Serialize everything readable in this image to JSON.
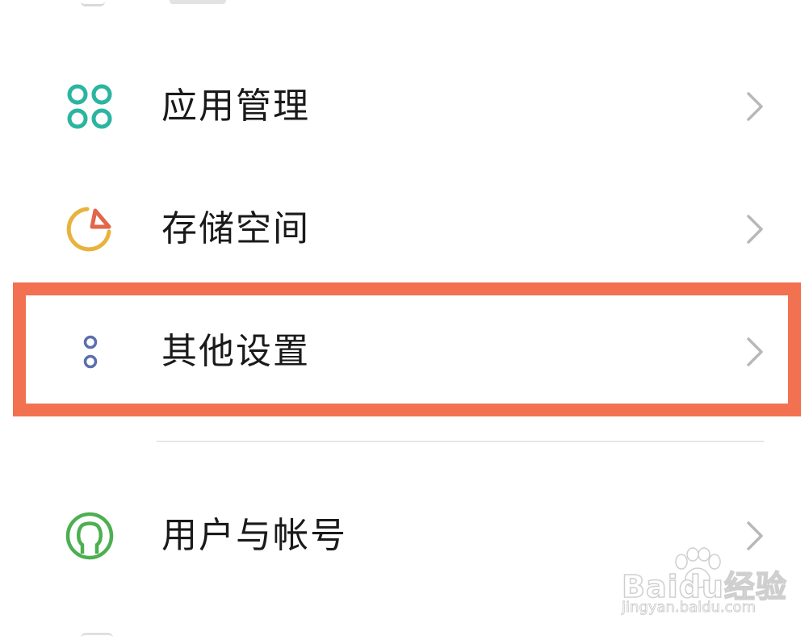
{
  "settings": {
    "items": [
      {
        "label": "应用管理",
        "icon": "app-management-icon",
        "icon_color": "#2bb5a0"
      },
      {
        "label": "存储空间",
        "icon": "storage-icon",
        "icon_color": "#e8b33c",
        "accent_color": "#e2664a"
      },
      {
        "label": "其他设置",
        "icon": "other-settings-icon",
        "icon_color": "#5b6fae",
        "highlighted": true
      },
      {
        "label": "用户与帐号",
        "icon": "user-account-icon",
        "icon_color": "#4caf50"
      }
    ],
    "chevron_icon": "chevron-right-icon"
  },
  "highlight": {
    "color": "#f27150"
  },
  "watermark": {
    "brand": "Baidu经验",
    "url": "jingyan.baidu.com"
  }
}
